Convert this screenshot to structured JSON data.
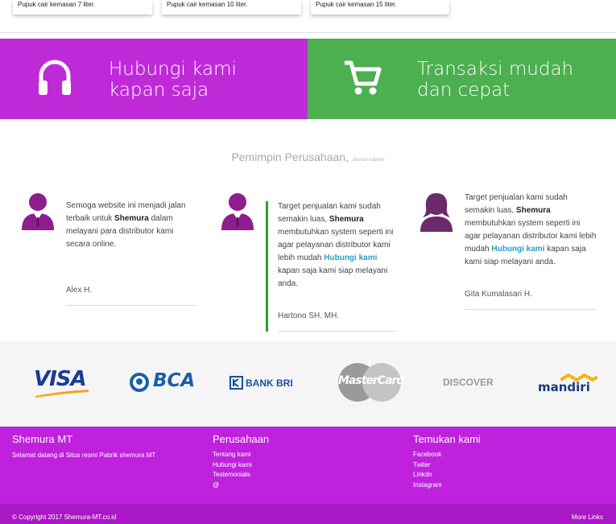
{
  "products": [
    {
      "desc": "Pupuk cair kemasan 7 liter."
    },
    {
      "desc": "Pupuk cair kemasan 10 liter."
    },
    {
      "desc": "Pupuk cair kemasan 15 liter."
    }
  ],
  "banners": {
    "contact": {
      "text": "Hubungi kami kapan saja",
      "icon": "headphones-icon",
      "color": "#bf2ad8"
    },
    "transaction": {
      "text": "Transaksi mudah dan cepat",
      "icon": "shopping-cart-icon",
      "color": "#4caf50"
    }
  },
  "leaders": {
    "title": "Pemimpin Perusahaan,",
    "subtitle": "Jajaran kabinet",
    "items": [
      {
        "q1": "Semoga website ini menjadi jalan terbaik untuk ",
        "bold": "Shemura",
        "q2": " dalam melayani para distributor kami secara online.",
        "author": "Alex H."
      },
      {
        "q1": "Target penjualan kami sudah semakin luas, ",
        "bold": "Shemura",
        "q2": " membutuhkan system seperti ini agar pelayanan distributor kami lebih mudah ",
        "link": "Hubungi kami",
        "q3": " kapan saja kami siap melayani anda.",
        "author": "Hartono SH. MH."
      },
      {
        "q1": "Target penjualan kami sudah semakin luas, ",
        "bold": "Shemura",
        "q2": " membutuhkan system seperti ini agar pelayanan distributor kami lebih mudah ",
        "link": "Hubungi kami",
        "q3": " kapan saja kami siap melayani anda.",
        "author": "Gita Kumalasari H."
      }
    ]
  },
  "payments": {
    "visa": "VISA",
    "bca": "BCA",
    "bri": "BANK BRI",
    "mastercard": "MasterCard",
    "discover": "DISCOVER",
    "mandiri": "mandiri"
  },
  "footer": {
    "col1": {
      "title": "Shemura MT",
      "text": "Selamat datang di Situs resmi Pabrik shemura MT"
    },
    "col2": {
      "title": "Perusahaan",
      "links": [
        "Tentang kami",
        "Hubungi kami",
        "Testemonials",
        "@"
      ]
    },
    "col3": {
      "title": "Temukan kami",
      "links": [
        "Facebook",
        "Twiter",
        "Linkdn",
        "Instagram"
      ]
    },
    "copyright": "© Copyright 2017 Shemura-MT.co.id",
    "more": "More Links"
  }
}
